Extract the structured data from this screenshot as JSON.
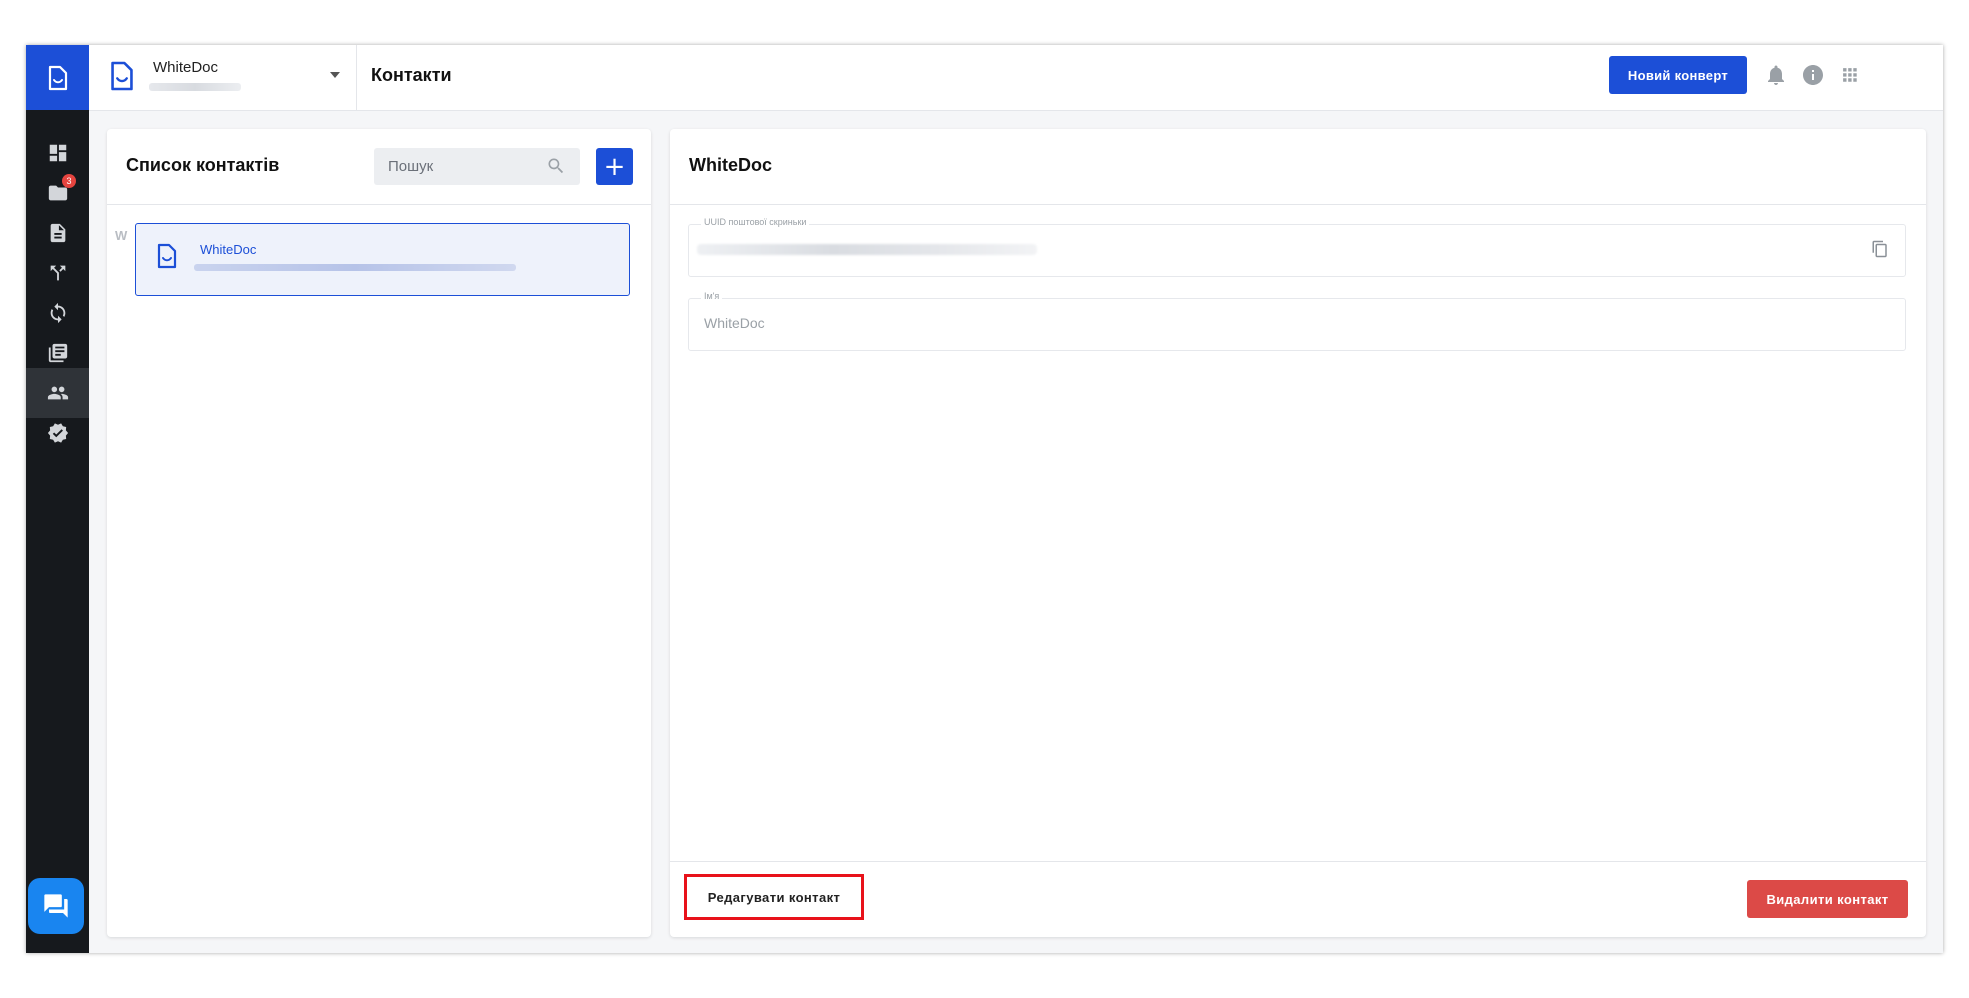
{
  "topbar": {
    "org_name": "WhiteDoc",
    "page_title": "Контакти",
    "new_envelope_label": "Новий конверт",
    "icons": [
      "bell-icon",
      "info-icon",
      "apps-grid-icon",
      "whitedoc-logo"
    ]
  },
  "sidebar": {
    "items": [
      {
        "name": "dashboard-icon"
      },
      {
        "name": "folder-icon",
        "badge": "3"
      },
      {
        "name": "document-icon"
      },
      {
        "name": "routes-icon"
      },
      {
        "name": "sync-icon"
      },
      {
        "name": "library-icon"
      },
      {
        "name": "contacts-icon",
        "active": true
      },
      {
        "name": "verified-icon"
      }
    ],
    "chat_icon": "chat-icon"
  },
  "contacts_list": {
    "title": "Список контактів",
    "search_placeholder": "Пошук",
    "add_label": "+",
    "group_letter": "W",
    "items": [
      {
        "name": "WhiteDoc"
      }
    ]
  },
  "contact_detail": {
    "title": "WhiteDoc",
    "uuid_label": "UUID поштової скриньки",
    "name_label": "Ім'я",
    "name_value": "WhiteDoc",
    "edit_label": "Редагувати контакт",
    "delete_label": "Видалити контакт"
  },
  "colors": {
    "accent": "#1c4fd7",
    "sidebar_bg": "#16191d",
    "danger": "#dc4a47",
    "highlight_border": "#e8121a"
  }
}
